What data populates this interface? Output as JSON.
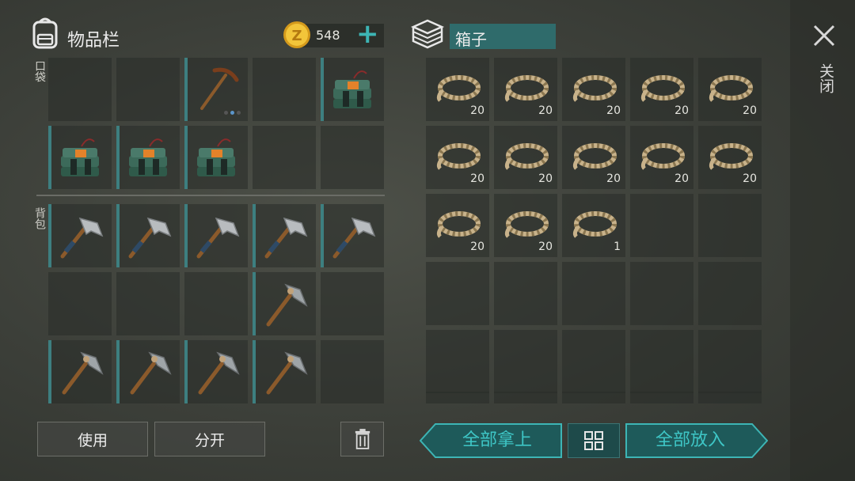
{
  "inventory": {
    "title": "物品栏",
    "coins": "548",
    "coin_symbol": "Z",
    "plus_label": "+",
    "pocket_label": "口袋",
    "backpack_label": "背包",
    "pockets": [
      {
        "item": "empty"
      },
      {
        "item": "empty"
      },
      {
        "item": "pickaxe-icon",
        "selected": true
      },
      {
        "item": "empty"
      },
      {
        "item": "explosive-icon"
      },
      {
        "item": "explosive-icon"
      },
      {
        "item": "explosive-icon"
      },
      {
        "item": "explosive-icon"
      },
      {
        "item": "empty"
      },
      {
        "item": "empty"
      }
    ],
    "backpack": [
      {
        "item": "hatchet-icon"
      },
      {
        "item": "hatchet-icon"
      },
      {
        "item": "hatchet-icon"
      },
      {
        "item": "hatchet-icon"
      },
      {
        "item": "hatchet-icon"
      },
      {
        "item": "empty"
      },
      {
        "item": "empty"
      },
      {
        "item": "empty"
      },
      {
        "item": "stone-hammer-icon"
      },
      {
        "item": "empty"
      },
      {
        "item": "stone-hammer-icon"
      },
      {
        "item": "stone-hammer-icon"
      },
      {
        "item": "stone-hammer-icon"
      },
      {
        "item": "stone-hammer-icon"
      },
      {
        "item": "empty"
      }
    ],
    "use_button": "使用",
    "split_button": "分开"
  },
  "box": {
    "title": "箱子",
    "slots": [
      {
        "item": "rope-icon",
        "count": "20"
      },
      {
        "item": "rope-icon",
        "count": "20"
      },
      {
        "item": "rope-icon",
        "count": "20"
      },
      {
        "item": "rope-icon",
        "count": "20"
      },
      {
        "item": "rope-icon",
        "count": "20"
      },
      {
        "item": "rope-icon",
        "count": "20"
      },
      {
        "item": "rope-icon",
        "count": "20"
      },
      {
        "item": "rope-icon",
        "count": "20"
      },
      {
        "item": "rope-icon",
        "count": "20"
      },
      {
        "item": "rope-icon",
        "count": "20"
      },
      {
        "item": "rope-icon",
        "count": "20"
      },
      {
        "item": "rope-icon",
        "count": "20"
      },
      {
        "item": "rope-icon",
        "count": "1"
      },
      {
        "item": "empty"
      },
      {
        "item": "empty"
      },
      {
        "item": "empty"
      },
      {
        "item": "empty"
      },
      {
        "item": "empty"
      },
      {
        "item": "empty"
      },
      {
        "item": "empty"
      },
      {
        "item": "empty"
      },
      {
        "item": "empty"
      },
      {
        "item": "empty"
      },
      {
        "item": "empty"
      },
      {
        "item": "empty"
      }
    ],
    "take_all": "全部拿上",
    "put_all": "全部放入"
  },
  "close_label": "关闭",
  "colors": {
    "accent": "#3db5b5",
    "accent_dark": "#1f5a5a",
    "slot_bar": "#3d7f80"
  }
}
